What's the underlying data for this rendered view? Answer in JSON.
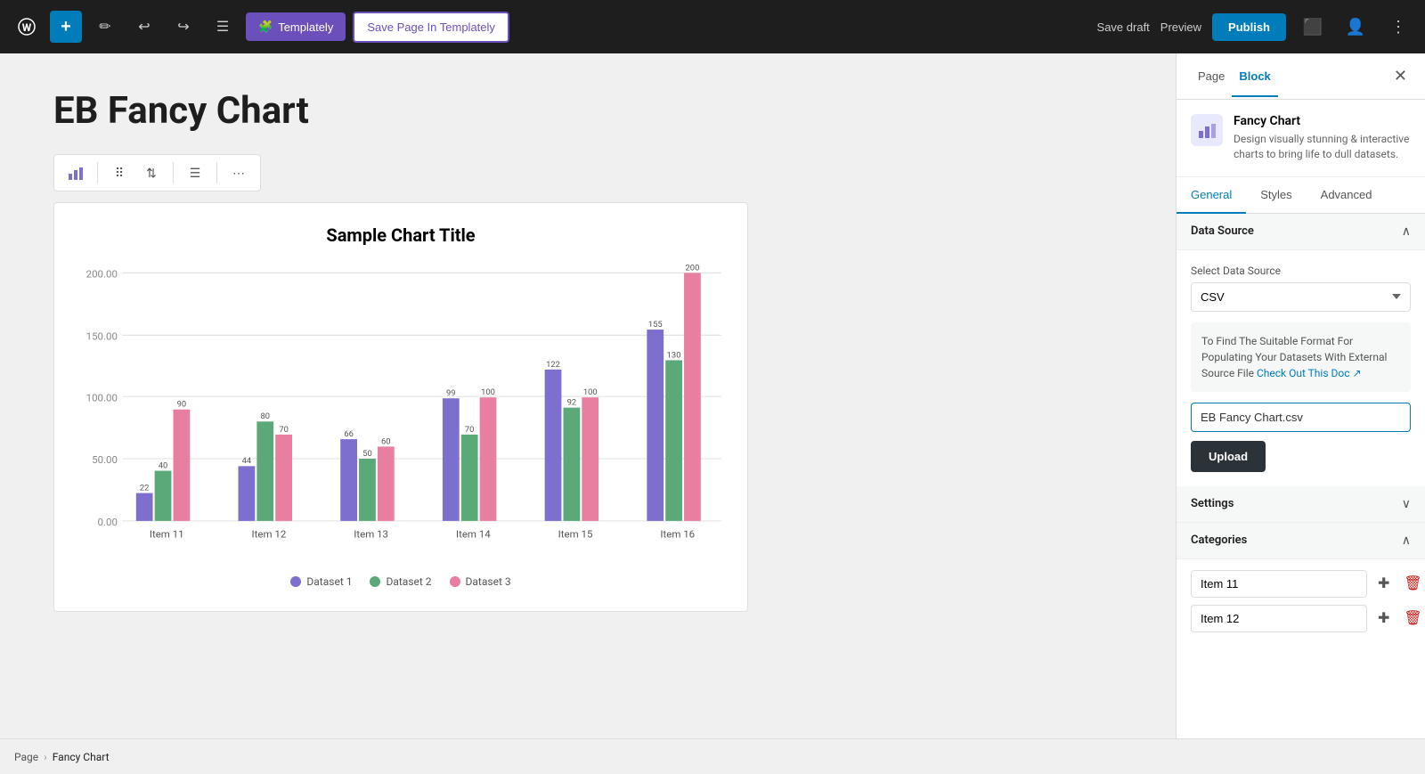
{
  "toolbar": {
    "add_label": "+",
    "wp_logo": "W",
    "templately_label": "Templately",
    "save_templately_label": "Save Page In Templately",
    "save_draft_label": "Save draft",
    "preview_label": "Preview",
    "publish_label": "Publish"
  },
  "editor": {
    "page_title": "EB Fancy Chart",
    "chart_title": "Sample Chart Title"
  },
  "chart": {
    "y_labels": [
      "200.00",
      "150.00",
      "100.00",
      "50.00",
      "0.00"
    ],
    "x_labels": [
      "Item 11",
      "Item 12",
      "Item 13",
      "Item 14",
      "Item 15",
      "Item 16"
    ],
    "datasets": [
      {
        "name": "Dataset 1",
        "color": "#7c6fcd",
        "values": [
          22,
          44,
          66,
          99,
          122,
          155
        ]
      },
      {
        "name": "Dataset 2",
        "color": "#5ba878",
        "values": [
          40,
          80,
          50,
          70,
          92,
          130
        ]
      },
      {
        "name": "Dataset 3",
        "color": "#e87fa0",
        "values": [
          90,
          70,
          60,
          100,
          100,
          200
        ]
      }
    ],
    "legend": [
      "Dataset 1",
      "Dataset 2",
      "Dataset 3"
    ],
    "legend_colors": [
      "#7c6fcd",
      "#5ba878",
      "#e87fa0"
    ]
  },
  "sidebar": {
    "page_tab": "Page",
    "block_tab": "Block",
    "plugin_name": "Fancy Chart",
    "plugin_desc": "Design visually stunning & interactive charts to bring life to dull datasets.",
    "tabs": {
      "general": "General",
      "styles": "Styles",
      "advanced": "Advanced"
    },
    "data_source_section": "Data Source",
    "select_data_source_label": "Select Data Source",
    "data_source_value": "CSV",
    "info_text": "To Find The Suitable Format For Populating Your Datasets With External Source File",
    "info_link": "Check Out This Doc",
    "file_name": "EB Fancy Chart.csv",
    "upload_label": "Upload",
    "settings_section": "Settings",
    "categories_section": "Categories",
    "category_item_11": "Item 11",
    "category_item_12": "Item 12"
  },
  "breadcrumb": {
    "page_label": "Page",
    "separator": "›",
    "current": "Fancy Chart"
  }
}
